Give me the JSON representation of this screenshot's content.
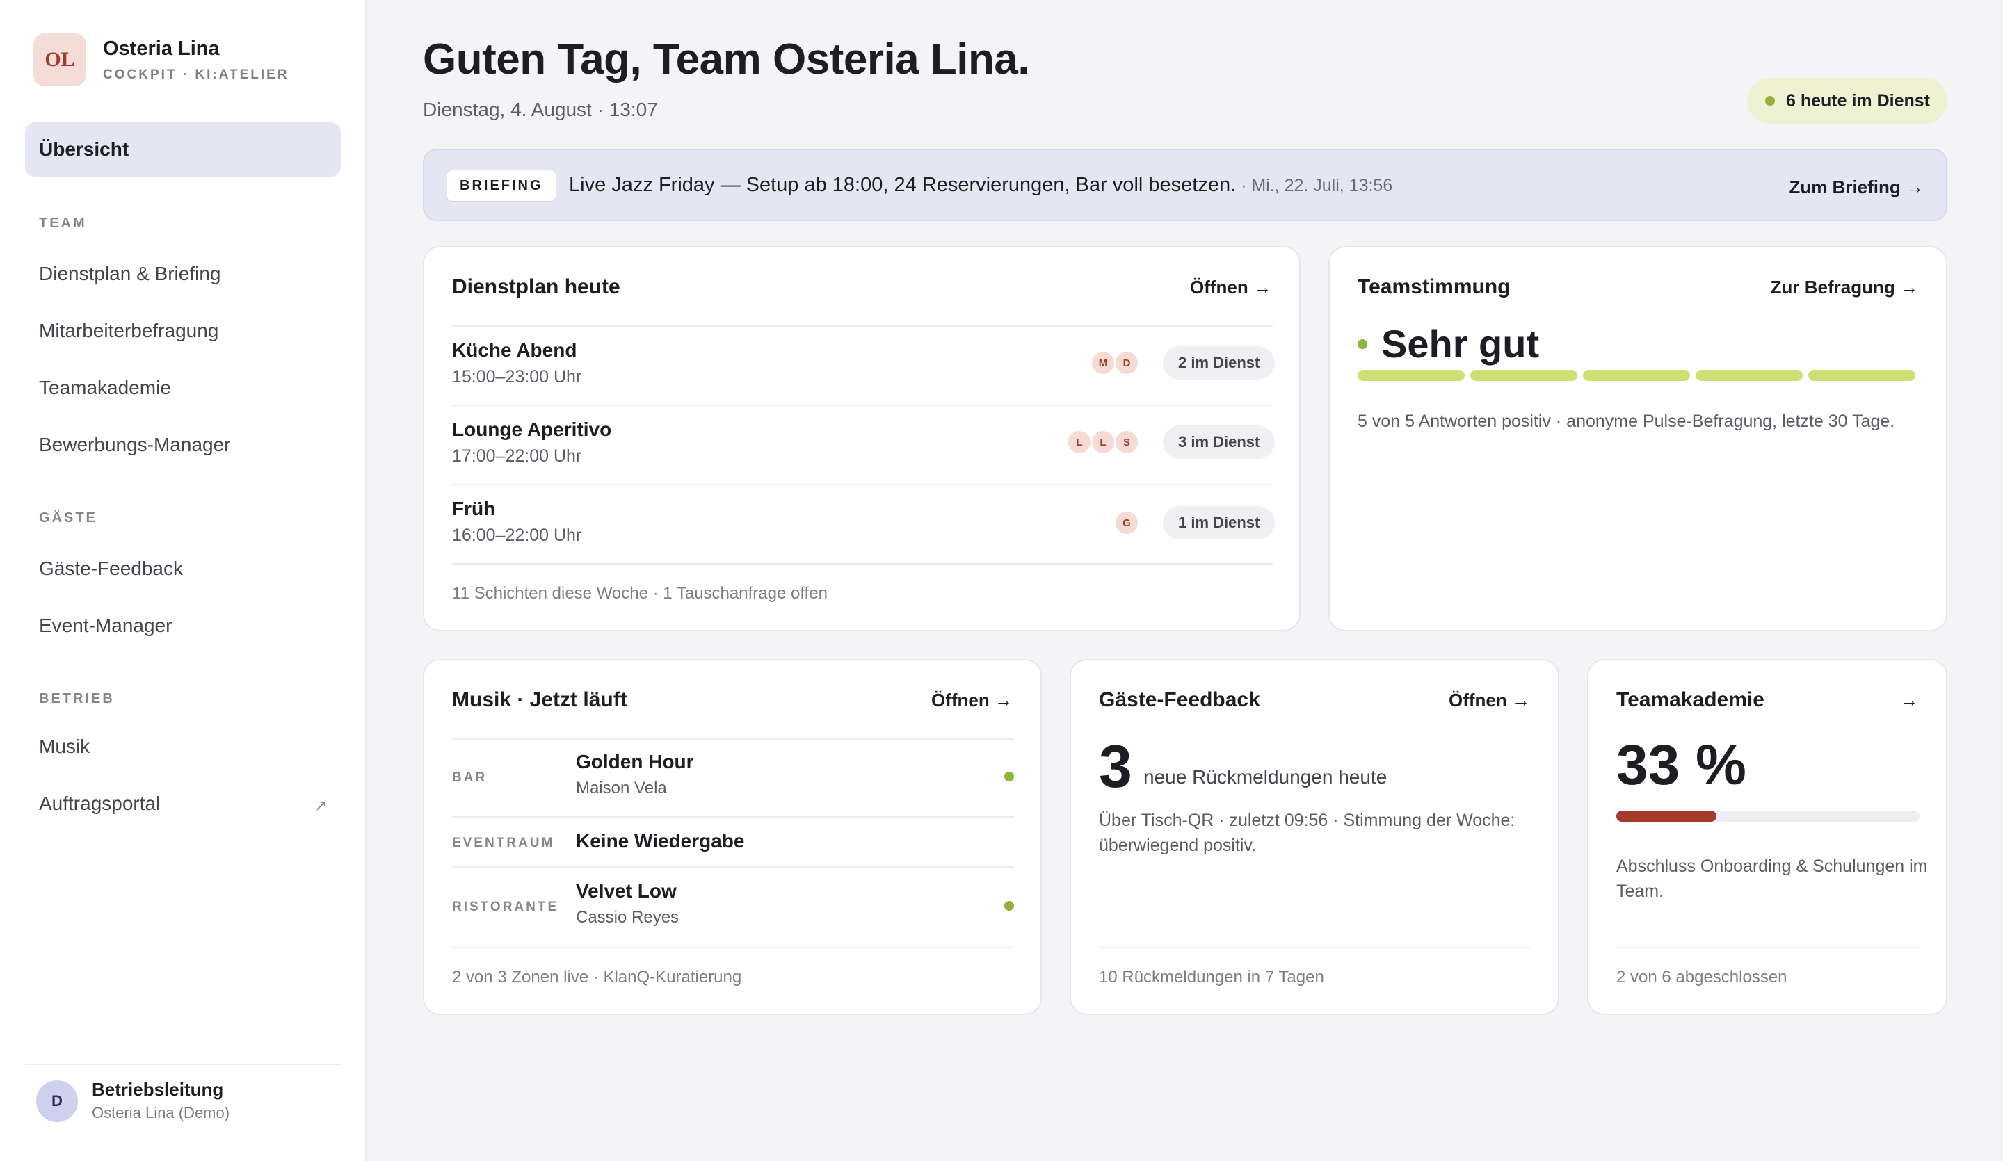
{
  "sidebar": {
    "brand": {
      "logo": "OL",
      "name": "Osteria Lina",
      "subtitle": "COCKPIT · KI:ATELIER"
    },
    "active_item": "Übersicht",
    "sections": [
      {
        "title": "TEAM",
        "items": [
          "Dienstplan & Briefing",
          "Mitarbeiterbefragung",
          "Teamakademie",
          "Bewerbungs-Manager"
        ]
      },
      {
        "title": "GÄSTE",
        "items": [
          "Gäste-Feedback",
          "Event-Manager"
        ]
      },
      {
        "title": "BETRIEB",
        "items": [
          "Musik",
          "Auftragsportal"
        ]
      }
    ],
    "external_icon": "↗",
    "user": {
      "initial": "D",
      "role": "Betriebsleitung",
      "org": "Osteria Lina (Demo)"
    }
  },
  "header": {
    "greeting": "Guten Tag, Team Osteria Lina.",
    "datetime": "Dienstag, 4. August · 13:07",
    "on_duty": "6 heute im Dienst"
  },
  "briefing": {
    "tag": "BRIEFING",
    "text": "Live Jazz Friday — Setup ab 18:00, 24 Reservierungen, Bar voll besetzen.",
    "meta": " · Mi., 22. Juli, 13:56",
    "link": "Zum Briefing →"
  },
  "roster": {
    "title": "Dienstplan heute",
    "link": "Öffnen →",
    "shifts": [
      {
        "name": "Küche Abend",
        "time": "15:00–23:00 Uhr",
        "staff": [
          "M",
          "D"
        ],
        "badge": "2 im Dienst"
      },
      {
        "name": "Lounge Aperitivo",
        "time": "17:00–22:00 Uhr",
        "staff": [
          "L",
          "L",
          "S"
        ],
        "badge": "3 im Dienst"
      },
      {
        "name": "Früh",
        "time": "16:00–22:00 Uhr",
        "staff": [
          "G"
        ],
        "badge": "1 im Dienst"
      }
    ],
    "footer": "11 Schichten diese Woche · 1 Tauschanfrage offen"
  },
  "mood": {
    "title": "Teamstimmung",
    "link": "Zur Befragung →",
    "value": "Sehr gut",
    "filled_segments": 5,
    "total_segments": 5,
    "note": "5 von 5 Antworten positiv · anonyme Pulse-Befragung, letzte 30 Tage.",
    "color": "#cfdf73"
  },
  "music": {
    "title": "Musik · Jetzt läuft",
    "link": "Öffnen →",
    "zones": [
      {
        "zone": "BAR",
        "track": "Golden Hour",
        "artist": "Maison Vela",
        "live": true
      },
      {
        "zone": "EVENTRAUM",
        "track": "Keine Wiedergabe",
        "artist": "",
        "live": false
      },
      {
        "zone": "RISTORANTE",
        "track": "Velvet Low",
        "artist": "Cassio Reyes",
        "live": true
      }
    ],
    "footer": "2 von 3 Zonen live · KlanQ-Kuratierung"
  },
  "feedback": {
    "title": "Gäste-Feedback",
    "link": "Öffnen →",
    "count": "3",
    "caption": "neue Rückmeldungen heute",
    "body": "Über Tisch-QR · zuletzt 09:56 · Stimmung der Woche: überwiegend positiv.",
    "footer": "10 Rückmeldungen in 7 Tagen"
  },
  "academy": {
    "title": "Teamakademie",
    "link": "→",
    "percent": "33 %",
    "progress": 0.33,
    "body": "Abschluss Onboarding & Schulungen im Team.",
    "footer": "2 von 6 abgeschlossen",
    "color": "#a33a2c"
  }
}
